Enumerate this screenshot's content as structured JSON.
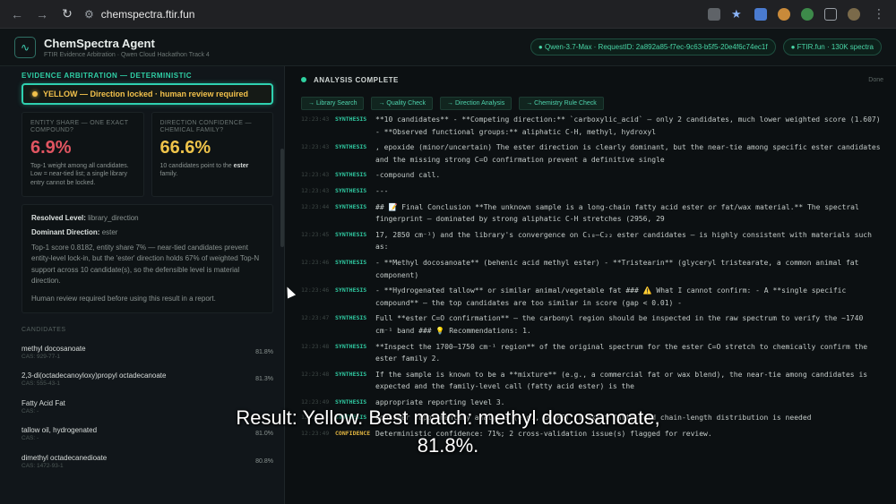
{
  "browser": {
    "url": "chemspectra.ftir.fun"
  },
  "header": {
    "title": "ChemSpectra Agent",
    "subtitle": "FTIR Evidence Arbitration · Qwen Cloud Hackathon Track 4",
    "pill_model": "● Qwen-3.7-Max · RequestID: 2a892a85-f7ec-9c63-b5f5-20e4f6c74ec1f",
    "pill_db": "● FTIR.fun · 130K spectra"
  },
  "evidence": {
    "title": "EVIDENCE ARBITRATION — DETERMINISTIC",
    "verdict": "YELLOW — Direction locked · human review required",
    "entity_label": "ENTITY SHARE — ONE EXACT COMPOUND?",
    "entity_value": "6.9%",
    "entity_note": "Top-1 weight among all candidates. Low = near-tied list; a single library entry cannot be locked.",
    "direction_label": "DIRECTION CONFIDENCE — CHEMICAL FAMILY?",
    "direction_value": "66.6%",
    "direction_note_a": "10 candidates point to the ",
    "direction_note_b": "ester",
    "direction_note_c": " family.",
    "resolved_label": "Resolved Level:",
    "resolved_value": "library_direction",
    "dominant_label": "Dominant Direction:",
    "dominant_value": "ester",
    "summary": "Top-1 score 0.8182, entity share 7% — near-tied candidates prevent entity-level lock-in, but the 'ester' direction holds 67% of weighted Top-N support across 10 candidate(s), so the defensible level is material direction.",
    "review_note": "Human review required before using this result in a report."
  },
  "candidates": {
    "title": "CANDIDATES",
    "items": [
      {
        "name": "methyl docosanoate",
        "cas": "CAS: 929-77-1",
        "score": "81.8%"
      },
      {
        "name": "2,3-di(octadecanoyloxy)propyl octadecanoate",
        "cas": "CAS: 555-43-1",
        "score": "81.3%"
      },
      {
        "name": "Fatty Acid Fat",
        "cas": "CAS: -",
        "score": ""
      },
      {
        "name": "tallow oil, hydrogenated",
        "cas": "CAS: -",
        "score": "81.0%"
      },
      {
        "name": "dimethyl octadecanedioate",
        "cas": "CAS: 1472-93-1",
        "score": "80.8%"
      }
    ]
  },
  "analysis": {
    "title": "ANALYSIS COMPLETE",
    "done": "Done",
    "steps": [
      "→ Library Search",
      "→ Quality Check",
      "→ Direction Analysis",
      "→ Chemistry Rule Check"
    ],
    "log": [
      {
        "time": "12:23:43",
        "tag": "SYNTHESIS",
        "text": "**10 candidates** - **Competing direction:** `carboxylic_acid` — only 2 candidates, much lower weighted score (1.607) - **Observed functional groups:** aliphatic C-H, methyl, hydroxyl"
      },
      {
        "time": "12:23:43",
        "tag": "SYNTHESIS",
        "text": ", epoxide (minor/uncertain) The ester direction is clearly dominant, but the near-tie among specific ester candidates and the missing strong C=O confirmation prevent a definitive single"
      },
      {
        "time": "12:23:43",
        "tag": "SYNTHESIS",
        "text": "-compound call."
      },
      {
        "time": "12:23:43",
        "tag": "SYNTHESIS",
        "text": "---"
      },
      {
        "time": "12:23:44",
        "tag": "SYNTHESIS",
        "text": "## 📝 Final Conclusion **The unknown sample is a long-chain fatty acid ester or fat/wax material.** The spectral fingerprint — dominated by strong aliphatic C-H stretches (2956, 29"
      },
      {
        "time": "12:23:45",
        "tag": "SYNTHESIS",
        "text": "17, 2850 cm⁻¹) and the library's convergence on C₁₈–C₂₂ ester candidates — is highly consistent with materials such as:"
      },
      {
        "time": "12:23:46",
        "tag": "SYNTHESIS",
        "text": "- **Methyl docosanoate** (behenic acid methyl ester) - **Tristearin** (glyceryl tristearate, a common animal fat component)"
      },
      {
        "time": "12:23:46",
        "tag": "SYNTHESIS",
        "text": "- **Hydrogenated tallow** or similar animal/vegetable fat ### ⚠️ What I cannot confirm: - A **single specific compound** — the top candidates are too similar in score (gap < 0.01) -"
      },
      {
        "time": "12:23:47",
        "tag": "SYNTHESIS",
        "text": "Full **ester C=O confirmation** — the carbonyl region should be inspected in the raw spectrum to verify the ~1740 cm⁻¹ band ### 💡 Recommendations: 1."
      },
      {
        "time": "12:23:48",
        "tag": "SYNTHESIS",
        "text": "**Inspect the 1700–1750 cm⁻¹ region** of the original spectrum for the ester C=O stretch to chemically confirm the ester family 2."
      },
      {
        "time": "12:23:48",
        "tag": "SYNTHESIS",
        "text": "If the sample is known to be a **mixture** (e.g., a commercial fat or wax blend), the near-tie among candidates is expected and the family-level call (fatty acid ester) is the"
      },
      {
        "time": "12:23:49",
        "tag": "SYNTHESIS",
        "text": "appropriate reporting level 3."
      },
      {
        "time": "12:23:49",
        "tag": "SYNTHESIS",
        "text": "Consider supplementary analysis (e.g., GC-MS) if exact fatty acid chain-length distribution is needed"
      },
      {
        "time": "12:23:49",
        "tag": "CONFIDENCE",
        "text": "Deterministic confidence: 71%; 2 cross-validation issue(s) flagged for review."
      }
    ]
  },
  "caption": {
    "line1": "Result: Yellow. Best match: methyl docosanoate,",
    "line2": "81.8%."
  }
}
